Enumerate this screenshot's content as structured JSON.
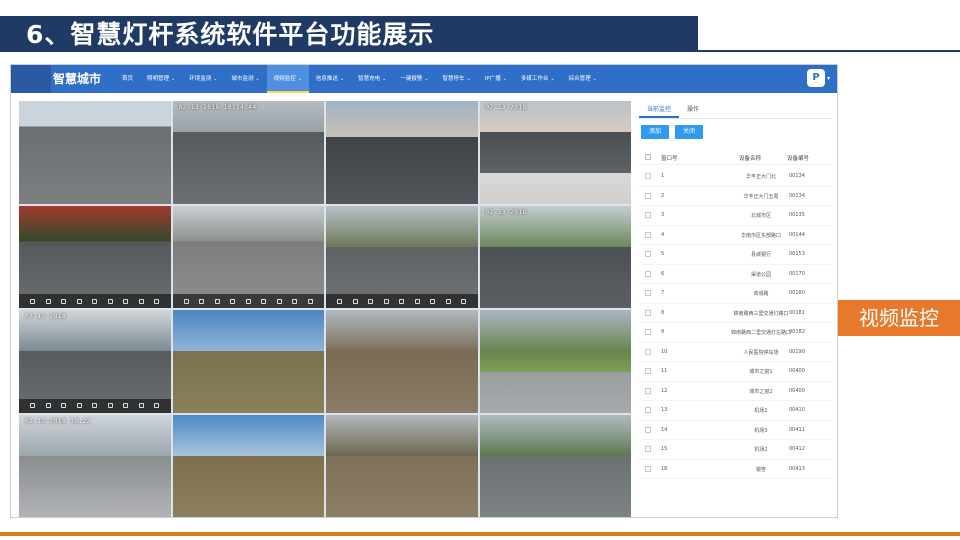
{
  "slide": {
    "title": "6、智慧灯杆系统软件平台功能展示",
    "callout": "视频监控"
  },
  "app": {
    "logo": "智慧城市",
    "nav": [
      {
        "label": "首页",
        "active": false
      },
      {
        "label": "照明管理",
        "active": false
      },
      {
        "label": "环境监测",
        "active": false
      },
      {
        "label": "城市监测",
        "active": false
      },
      {
        "label": "视频监控",
        "active": true
      },
      {
        "label": "信息推送",
        "active": false
      },
      {
        "label": "智慧充电",
        "active": false
      },
      {
        "label": "一键报警",
        "active": false
      },
      {
        "label": "智慧停车",
        "active": false
      },
      {
        "label": "IP广播",
        "active": false
      },
      {
        "label": "多媒工作台",
        "active": false
      },
      {
        "label": "综合管理",
        "active": false
      }
    ],
    "brand_badge": "P"
  },
  "video_cells": [
    {
      "timestamp": "",
      "toolbar": false
    },
    {
      "timestamp": "02-13-2018  10:24:44",
      "toolbar": false
    },
    {
      "timestamp": "",
      "toolbar": false
    },
    {
      "timestamp": "02-13-2018",
      "toolbar": false
    },
    {
      "timestamp": "",
      "toolbar": true
    },
    {
      "timestamp": "",
      "toolbar": true
    },
    {
      "timestamp": "",
      "toolbar": true
    },
    {
      "timestamp": "02-13-2018",
      "toolbar": false
    },
    {
      "timestamp": "07-13-2018",
      "toolbar": true
    },
    {
      "timestamp": "",
      "toolbar": false
    },
    {
      "timestamp": "",
      "toolbar": false
    },
    {
      "timestamp": "",
      "toolbar": false
    },
    {
      "timestamp": "02-13-2018  10:22",
      "toolbar": false
    },
    {
      "timestamp": "",
      "toolbar": false
    },
    {
      "timestamp": "",
      "toolbar": false
    },
    {
      "timestamp": "",
      "toolbar": false
    }
  ],
  "panel": {
    "tabs": [
      {
        "label": "当前监控",
        "active": true
      },
      {
        "label": "操作",
        "active": false
      }
    ],
    "buttons": {
      "add": "添加",
      "close": "关闭"
    },
    "columns": [
      "窗口号",
      "设备名称",
      "设备编号"
    ],
    "rows": [
      {
        "no": "1",
        "name": "华丰正大门北",
        "id": "00134"
      },
      {
        "no": "2",
        "name": "华丰正大门五局",
        "id": "00134"
      },
      {
        "no": "3",
        "name": "北城市区",
        "id": "00135"
      },
      {
        "no": "4",
        "name": "华南市区东部路口",
        "id": "00144"
      },
      {
        "no": "5",
        "name": "县城银行",
        "id": "00153"
      },
      {
        "no": "6",
        "name": "渠道公园",
        "id": "00170"
      },
      {
        "no": "7",
        "name": "商城路",
        "id": "00180"
      },
      {
        "no": "8",
        "name": "锦南路西三里交通灯路口",
        "id": "00181"
      },
      {
        "no": "9",
        "name": "锦南路西二里交通灯左路口",
        "id": "00182"
      },
      {
        "no": "10",
        "name": "人民医院停车场",
        "id": "00190"
      },
      {
        "no": "11",
        "name": "城市之窗1",
        "id": "00400"
      },
      {
        "no": "12",
        "name": "城市之窗2",
        "id": "00400"
      },
      {
        "no": "13",
        "name": "机场1",
        "id": "00410"
      },
      {
        "no": "14",
        "name": "机场3",
        "id": "00411"
      },
      {
        "no": "15",
        "name": "机场2",
        "id": "00412"
      },
      {
        "no": "16",
        "name": "银杏",
        "id": "00413"
      }
    ]
  },
  "colors": {
    "title_bar": "#1f3a64",
    "accent_orange": "#e8782b",
    "nav_blue": "#2f6fc7",
    "button_blue": "#2e9af0"
  }
}
